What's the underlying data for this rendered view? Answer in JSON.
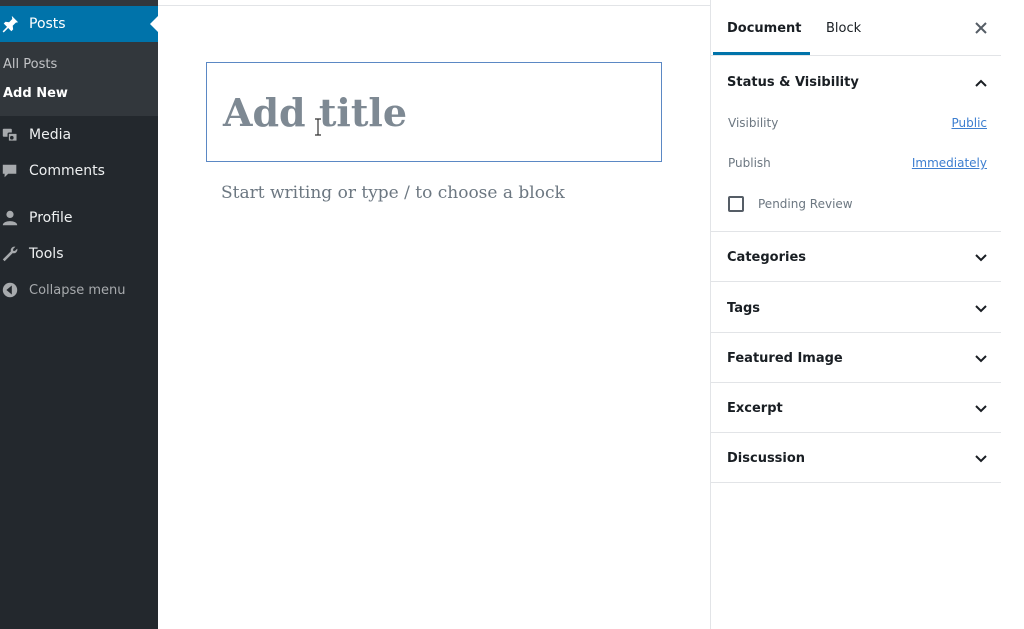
{
  "sidebar": {
    "posts": "Posts",
    "all_posts": "All Posts",
    "add_new": "Add New",
    "items": [
      {
        "label": "Media",
        "icon": "media-icon"
      },
      {
        "label": "Comments",
        "icon": "comments-icon"
      },
      {
        "label": "Profile",
        "icon": "profile-icon"
      },
      {
        "label": "Tools",
        "icon": "tools-icon"
      },
      {
        "label": "Collapse menu",
        "icon": "collapse-icon"
      }
    ]
  },
  "editor": {
    "title_placeholder": "Add title",
    "block_placeholder": "Start writing or type / to choose a block"
  },
  "panel": {
    "tabs": [
      "Document",
      "Block"
    ],
    "status": {
      "title": "Status & Visibility",
      "visibility_label": "Visibility",
      "visibility_value": "Public",
      "publish_label": "Publish",
      "publish_value": "Immediately",
      "pending_review": "Pending Review",
      "pending_checked": false
    },
    "sections": [
      "Categories",
      "Tags",
      "Featured Image",
      "Excerpt",
      "Discussion"
    ]
  },
  "colors": {
    "sidebar_bg": "#23282d",
    "accent": "#0073aa",
    "link": "#3c7ed0"
  }
}
